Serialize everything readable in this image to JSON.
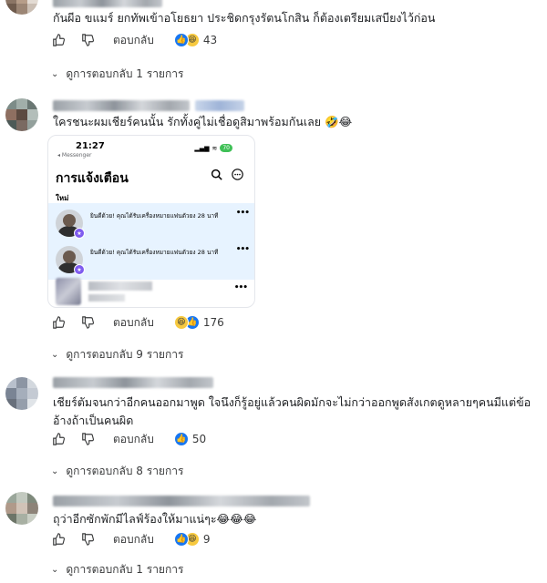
{
  "comments": [
    {
      "text": "กันผีอ ขแมร์ ยกทัพเข้าอโยธยา ประชิดกรุงรัตนโกสิน ก็ต้องเตรียมเสบียงไว้ก่อน",
      "reply_label": "ตอบกลับ",
      "reaction_count": "43",
      "view_replies": "ดูการตอบกลับ 1 รายการ"
    },
    {
      "text": "ใครชนะผมเชียร์คนนั้น รักทั้งคู่ไม่เชื่อดูสิมาพร้อมกันเลย 🤣😂",
      "reply_label": "ตอบกลับ",
      "reaction_count": "176",
      "view_replies": "ดูการตอบกลับ 9 รายการ",
      "attachment": {
        "time": "21:27",
        "app": "◂ Messenger",
        "battery": "70",
        "title": "การแจ้งเตือน",
        "section": "ใหม่",
        "notifications": [
          {
            "text": "ยินดีด้วย! คุณได้รับเครื่องหมายแฟนตัวยง 28 นาที"
          },
          {
            "text": "ยินดีด้วย! คุณได้รับเครื่องหมายแฟนตัวยง 28 นาที"
          }
        ]
      }
    },
    {
      "text": "เชียร์ตัมจนกว่าอีกคนออกมาพูด ใจนึงก็รู้อยู่แล้วคนผิดมักจะไม่กว่าออกพูดสังเกตดูหลายๆคนมีแต่ข้ออ้างถ้าเป็นคนผิด",
      "reply_label": "ตอบกลับ",
      "reaction_count": "50",
      "view_replies": "ดูการตอบกลับ 8 รายการ"
    },
    {
      "text": "ถุว่าอีกซักพักมีไลฟ์ร้องให้มาแน่ๆะ😂😂😂",
      "reply_label": "ตอบกลับ",
      "reaction_count": "9",
      "view_replies": "ดูการตอบกลับ 1 รายการ"
    }
  ],
  "icons": {
    "like": "thumbs-up-icon",
    "dislike": "thumbs-down-icon",
    "chevron": "chevron-down-icon",
    "search": "search-icon",
    "more": "more-icon"
  },
  "colors": {
    "like_blue": "#1877f2",
    "haha_yellow": "#f7c93f",
    "text": "#1c1e21",
    "secondary": "#3a3b3c",
    "notification_bg": "#e7f3ff"
  }
}
